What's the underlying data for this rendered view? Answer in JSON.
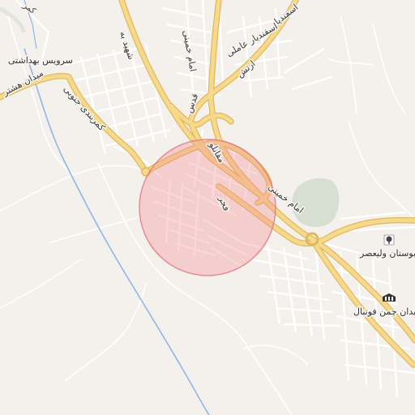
{
  "map": {
    "colors": {
      "background": "#f4f1ec",
      "street": "#ffffff",
      "street_casing": "#cfcac2",
      "main_road": "#f6d98a",
      "main_road_casing": "#e0b860",
      "river": "#8fb6e6",
      "park": "#d6dfd2",
      "radius_fill": "#f08c95",
      "radius_stroke": "#e07880"
    },
    "radius_circle": {
      "name": "selected-area"
    },
    "road_labels": [
      {
        "id": "shahid-beheshti",
        "text": "شهید به"
      },
      {
        "id": "esfandiar",
        "text": "اسفندیار"
      },
      {
        "id": "esfandiar-ayatollahi",
        "text": "اسفندیار عاملی"
      },
      {
        "id": "imam-khomeini-north",
        "text": "امام خمینی"
      },
      {
        "id": "artesh",
        "text": "ارتش"
      },
      {
        "id": "ghods",
        "text": "قدس"
      },
      {
        "id": "kamarbandi-jonubi",
        "text": "کمربندی جنوبی"
      },
      {
        "id": "meydan-hashtar",
        "text": "میدان هشتر"
      },
      {
        "id": "kamarbandi",
        "text": "کمر"
      },
      {
        "id": "moghanlou",
        "text": "مقانلو"
      },
      {
        "id": "fajr",
        "text": "فجر"
      },
      {
        "id": "imam-khomeini-south",
        "text": "امام خمینی"
      }
    ],
    "pois": [
      {
        "id": "health-service",
        "label": "سرویس بهداشتی",
        "icon": "toilet-icon"
      },
      {
        "id": "valiasr-park",
        "label": "بوستان ولیعصر",
        "icon": "tree-icon"
      },
      {
        "id": "football-field",
        "label": "میدان چمن فوتبال",
        "icon": "stadium-icon"
      }
    ]
  }
}
